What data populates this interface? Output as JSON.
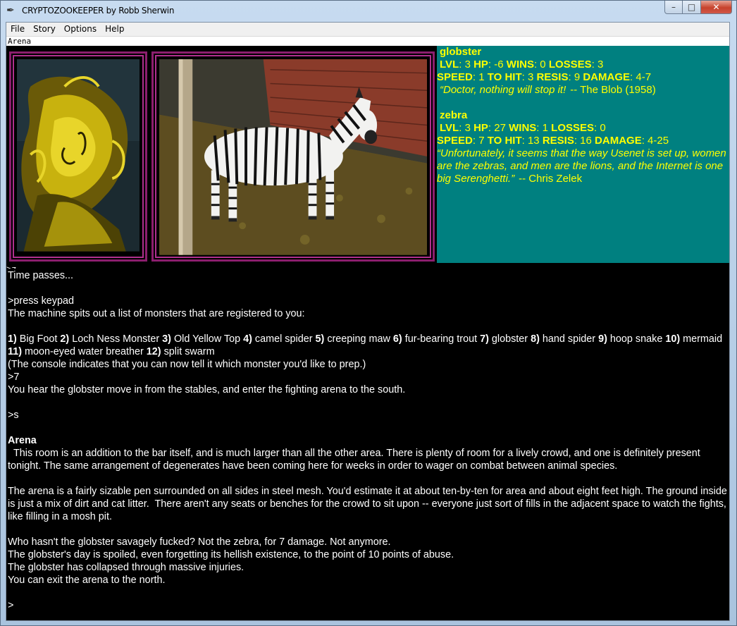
{
  "window": {
    "title": "CRYPTOZOOKEEPER by Robb Sherwin",
    "app_icon": "feather-pen-icon",
    "controls": {
      "minimize": "–",
      "maximize": "□",
      "close": "✕"
    }
  },
  "menubar": {
    "items": [
      "File",
      "Story",
      "Options",
      "Help"
    ]
  },
  "status_line": "Arena",
  "images": {
    "left": {
      "subject": "globster",
      "icon": "globster-creature-image",
      "colors": {
        "primary": "#c8b20e",
        "background": "#1b2a30"
      }
    },
    "right": {
      "subject": "zebra",
      "icon": "zebra-photo",
      "colors": {
        "ground": "#6b5a2c",
        "wall": "#8a3b2a"
      }
    }
  },
  "stats": {
    "colors": {
      "background": "#008080",
      "text": "#ffff00"
    },
    "creatures": [
      {
        "name": "globster",
        "lvl": "3",
        "hp": "-6",
        "wins": "0",
        "losses": "3",
        "speed": "1",
        "to_hit": "3",
        "resis": "9",
        "damage": "4-7",
        "quote": "“Doctor, nothing will stop it!",
        "quote_author": "-- The Blob (1958)"
      },
      {
        "name": "zebra",
        "lvl": "3",
        "hp": "27",
        "wins": "1",
        "losses": "0",
        "speed": "7",
        "to_hit": "13",
        "resis": "16",
        "damage": "4-25",
        "quote": "“Unfortunately, it seems that the way Usenet is set up, women are the zebras, and men are the lions, and the Internet is one big Serenghetti.”",
        "quote_author": "-- Chris Zelek"
      }
    ],
    "labels": {
      "lvl": "LVL",
      "hp": "HP",
      "wins": "WINS",
      "losses": "LOSSES",
      "speed": "SPEED",
      "to_hit": "TO HIT",
      "resis": "RESIS",
      "damage": "DAMAGE"
    }
  },
  "log": {
    "clipped_top": ">z",
    "time_passes": "Time passes...",
    "cmd_keypad": ">press keypad",
    "machine_spits": "The machine spits out a list of monsters that are registered to you:",
    "monsters": [
      {
        "num": "1)",
        "name": "Big Foot"
      },
      {
        "num": "2)",
        "name": "Loch Ness Monster"
      },
      {
        "num": "3)",
        "name": "Old Yellow Top"
      },
      {
        "num": "4)",
        "name": "camel spider"
      },
      {
        "num": "5)",
        "name": "creeping maw"
      },
      {
        "num": "6)",
        "name": "fur-bearing trout"
      },
      {
        "num": "7)",
        "name": "globster"
      },
      {
        "num": "8)",
        "name": "hand spider"
      },
      {
        "num": "9)",
        "name": "hoop snake"
      },
      {
        "num": "10)",
        "name": "mermaid"
      },
      {
        "num": "11)",
        "name": "moon-eyed water breather"
      },
      {
        "num": "12)",
        "name": "split swarm"
      }
    ],
    "console_hint": "(The console indicates that you can now tell it which monster you'd like to prep.)",
    "cmd_7": ">7",
    "hear_globster": "You hear the globster move in from the stables, and enter the fighting arena to the south.",
    "cmd_s": ">s",
    "room_title": "Arena",
    "room_desc_1": "  This room is an addition to the bar itself, and is much larger than all the other area. There is plenty of room for a lively crowd, and one is definitely present tonight. The same arrangement of degenerates have been coming here for weeks in order to wager on combat between animal species.",
    "room_desc_2": "The arena is a fairly sizable pen surrounded on all sides in steel mesh. You'd estimate it at about ten-by-ten for area and about eight feet high. The ground inside is just a mix of dirt and cat litter.  There aren't any seats or benches for the crowd to sit upon -- everyone just sort of fills in the adjacent space to watch the fights, like filling in a mosh pit.",
    "combat_1": "Who hasn't the globster savagely fucked? Not the zebra, for 7 damage. Not anymore.",
    "combat_2": "The globster's day is spoiled, even forgetting its hellish existence, to the point of 10 points of abuse.",
    "combat_3": "The globster has collapsed through massive injuries.",
    "combat_4": "You can exit the arena to the north.",
    "prompt": ">"
  }
}
